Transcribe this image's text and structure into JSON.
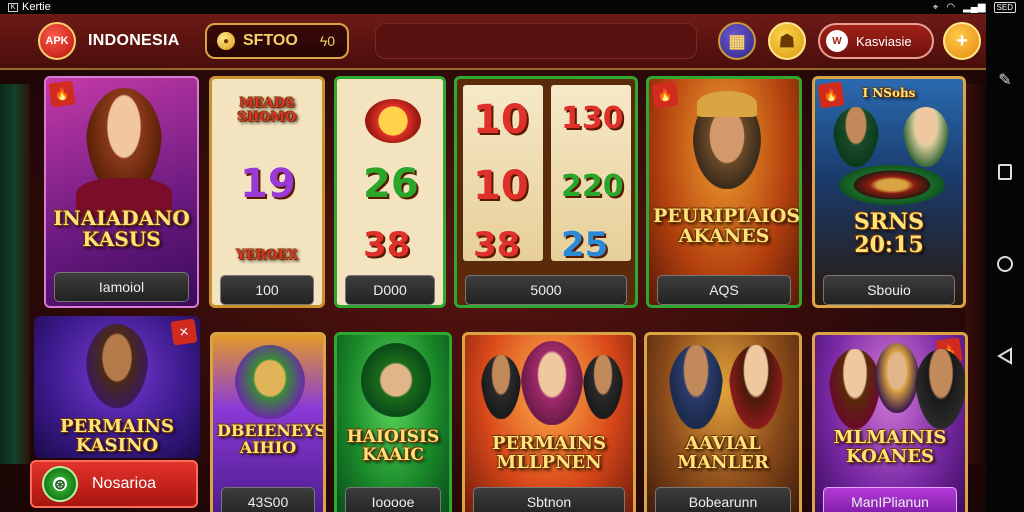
{
  "status_bar": {
    "left_text": "Kertie",
    "right_text": "SED"
  },
  "header": {
    "logo_text": "APK",
    "region": "INDONESIA",
    "balance": {
      "amount": "SFTOO",
      "secondary": "ϟ0"
    },
    "user_name": "Kasviasie",
    "plus_label": "+"
  },
  "cards_row1": [
    {
      "title": "INAIADANO KASUS",
      "button": "Iamoiol"
    },
    {
      "title": "MEADS SHOMO",
      "numbers": [
        "19",
        "YEROEX"
      ],
      "button": "100"
    },
    {
      "title": "",
      "numbers": [
        "26",
        "38"
      ],
      "button": "D000"
    },
    {
      "title": "",
      "numbers": [
        "10",
        "10",
        "38",
        "130",
        "220",
        "25"
      ],
      "button": "5000"
    },
    {
      "title": "PEURIPIAIOS AKANES",
      "button": "AQS"
    },
    {
      "title": "SRNS 20:15",
      "subtitle": "I NSohs",
      "button": "Sbouio"
    }
  ],
  "cards_row2": [
    {
      "title": "PERMAINS KASINO"
    },
    {
      "title": "DBEIENEYS AIHIO",
      "button": "43S00"
    },
    {
      "title": "HAIOISIS KAAIC",
      "button": "Iooooe"
    },
    {
      "title": "PERMAINS MLLPNEN",
      "button": "Sbtnon"
    },
    {
      "title": "AAVIAL MANLER",
      "button": "Bobearunn"
    },
    {
      "title": "MLMAINIS KOANES",
      "button": "ManIPlianun"
    }
  ],
  "bottom_button": {
    "label": "Nosarioa"
  },
  "colors": {
    "accent_gold": "#f5d06a",
    "header_red": "#6e1a16",
    "bg_dark": "#2b0a09"
  }
}
